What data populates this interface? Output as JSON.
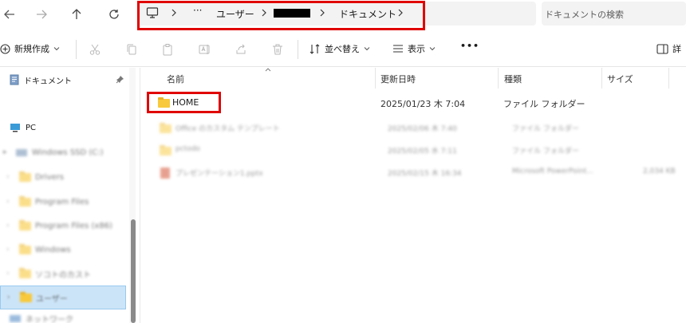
{
  "nav": {
    "back_icon": "arrow-left-icon",
    "forward_icon": "arrow-right-icon",
    "up_icon": "arrow-up-icon",
    "refresh_icon": "refresh-icon"
  },
  "address": {
    "root_icon": "monitor-icon",
    "ellipsis": "···",
    "crumbs": [
      "ユーザー",
      "ドキュメント"
    ]
  },
  "search": {
    "placeholder": "ドキュメントの検索"
  },
  "toolbar": {
    "new_label": "新規作成",
    "sort_label": "並べ替え",
    "view_label": "表示",
    "more_label": "•••",
    "details_label": "詳"
  },
  "sidebar": {
    "pinned": {
      "label": "ドキュメント"
    },
    "pc": {
      "label": "PC"
    },
    "drive": {
      "label": "Windows SSD (C:)"
    },
    "folders": [
      "Drivers",
      "Program Files",
      "Program Files (x86)",
      "Windows",
      "ソコトのカスト",
      "ユーザー"
    ],
    "bottom": "ネットワーク"
  },
  "columns": {
    "name": "名前",
    "modified": "更新日時",
    "type": "種類",
    "size": "サイズ"
  },
  "files": [
    {
      "name": "HOME",
      "modified": "2025/01/23 木 7:04",
      "type": "ファイル フォルダー",
      "size": ""
    },
    {
      "name": "Office のカスタム テンプレート",
      "modified": "2025/02/06 木 7:40",
      "type": "ファイル フォルダー",
      "size": ""
    },
    {
      "name": "pctodo",
      "modified": "2025/02/05 水 7:11",
      "type": "ファイル フォルダー",
      "size": ""
    },
    {
      "name": "プレゼンテーション1.pptx",
      "modified": "2025/02/15 木 16:34",
      "type": "Microsoft PowerPoint...",
      "size": "2,034 KB"
    }
  ],
  "colors": {
    "highlight": "#e00000",
    "selected": "#cce4f7",
    "folder": "#f8c93c"
  }
}
